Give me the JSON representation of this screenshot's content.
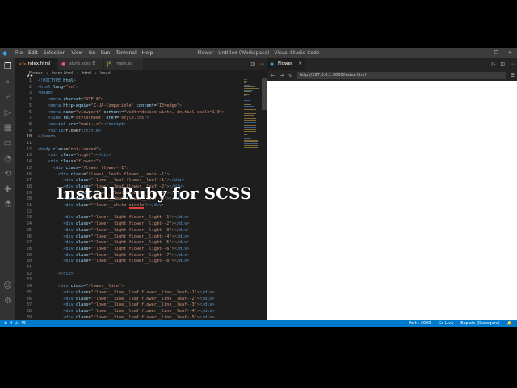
{
  "window": {
    "title": "Flower - Untitled (Workspace) - Visual Studio Code",
    "controls": [
      "–",
      "❐",
      "✕"
    ]
  },
  "menu": [
    "File",
    "Edit",
    "Selection",
    "View",
    "Go",
    "Run",
    "Terminal",
    "Help"
  ],
  "editor_tabs": [
    {
      "label": "index.html 9+",
      "icon": "html-file-icon",
      "active": true
    },
    {
      "label": "style.scss 8",
      "icon": "sass-file-icon",
      "active": false
    },
    {
      "label": "main.js",
      "icon": "js-file-icon",
      "active": false
    }
  ],
  "breadcrumb": [
    "Flower",
    "index.html",
    "html",
    "head"
  ],
  "code_lines": [
    {
      "n": "1",
      "parts": [
        [
          "t",
          "<!"
        ],
        [
          "tg",
          "DOCTYPE"
        ],
        [
          "at",
          " html"
        ],
        [
          "t",
          ">"
        ]
      ]
    },
    {
      "n": "2",
      "parts": [
        [
          "t",
          "<"
        ],
        [
          "tg",
          "html"
        ],
        [
          "at",
          " lang"
        ],
        [
          "tx",
          "="
        ],
        [
          "st",
          "\"en\""
        ],
        [
          "t",
          ">"
        ]
      ]
    },
    {
      "n": "3",
      "parts": [
        [
          "t",
          "<"
        ],
        [
          "tg",
          "head"
        ],
        [
          "t",
          ">"
        ]
      ]
    },
    {
      "n": "4",
      "parts": [
        [
          "tx",
          "    "
        ],
        [
          "t",
          "<"
        ],
        [
          "tg",
          "meta"
        ],
        [
          "at",
          " charset"
        ],
        [
          "tx",
          "="
        ],
        [
          "st",
          "\"UTF-8\""
        ],
        [
          "t",
          ">"
        ]
      ]
    },
    {
      "n": "5",
      "parts": [
        [
          "tx",
          "    "
        ],
        [
          "t",
          "<"
        ],
        [
          "tg",
          "meta"
        ],
        [
          "at",
          " http-equiv"
        ],
        [
          "tx",
          "="
        ],
        [
          "st",
          "\"X-UA-Compatible\""
        ],
        [
          "at",
          " content"
        ],
        [
          "tx",
          "="
        ],
        [
          "st",
          "\"IE=edge\""
        ],
        [
          "t",
          ">"
        ]
      ]
    },
    {
      "n": "6",
      "parts": [
        [
          "tx",
          "    "
        ],
        [
          "t",
          "<"
        ],
        [
          "tg",
          "meta"
        ],
        [
          "at",
          " name"
        ],
        [
          "tx",
          "="
        ],
        [
          "st",
          "\"viewport\""
        ],
        [
          "at",
          " content"
        ],
        [
          "tx",
          "="
        ],
        [
          "st",
          "\"width=device-width, initial-scale=1.0\""
        ],
        [
          "t",
          ">"
        ]
      ]
    },
    {
      "n": "7",
      "parts": [
        [
          "tx",
          "    "
        ],
        [
          "t",
          "<"
        ],
        [
          "tg",
          "link"
        ],
        [
          "at",
          " rel"
        ],
        [
          "tx",
          "="
        ],
        [
          "st",
          "\"stylesheet\""
        ],
        [
          "at",
          " href"
        ],
        [
          "tx",
          "="
        ],
        [
          "st",
          "\"style.css\""
        ],
        [
          "t",
          ">"
        ]
      ]
    },
    {
      "n": "8",
      "parts": [
        [
          "tx",
          "    "
        ],
        [
          "t",
          "<"
        ],
        [
          "tg",
          "script"
        ],
        [
          "at",
          " src"
        ],
        [
          "tx",
          "="
        ],
        [
          "st",
          "\"main.js\""
        ],
        [
          "t",
          "></"
        ],
        [
          "tg",
          "script"
        ],
        [
          "t",
          ">"
        ]
      ]
    },
    {
      "n": "9",
      "parts": [
        [
          "tx",
          "    "
        ],
        [
          "t",
          "<"
        ],
        [
          "tg",
          "title"
        ],
        [
          "t",
          ">"
        ],
        [
          "tx",
          "Flower"
        ],
        [
          "t",
          "</"
        ],
        [
          "tg",
          "title"
        ],
        [
          "t",
          ">"
        ]
      ]
    },
    {
      "n": "10",
      "parts": [
        [
          "t",
          "</"
        ],
        [
          "tg",
          "head"
        ],
        [
          "t",
          ">"
        ]
      ]
    },
    {
      "n": "11",
      "parts": []
    },
    {
      "n": "12",
      "parts": [
        [
          "t",
          "<"
        ],
        [
          "tg",
          "body"
        ],
        [
          "at",
          " class"
        ],
        [
          "tx",
          "="
        ],
        [
          "st",
          "\"not-loaded\""
        ],
        [
          "t",
          ">"
        ]
      ]
    },
    {
      "n": "13",
      "parts": [
        [
          "tx",
          "    "
        ],
        [
          "t",
          "<"
        ],
        [
          "tg",
          "div"
        ],
        [
          "at",
          " class"
        ],
        [
          "tx",
          "="
        ],
        [
          "st",
          "\"night\""
        ],
        [
          "t",
          "></"
        ],
        [
          "tg",
          "div"
        ],
        [
          "t",
          ">"
        ]
      ]
    },
    {
      "n": "14",
      "parts": [
        [
          "tx",
          "    "
        ],
        [
          "t",
          "<"
        ],
        [
          "tg",
          "div"
        ],
        [
          "at",
          " class"
        ],
        [
          "tx",
          "="
        ],
        [
          "st",
          "\"flowers\""
        ],
        [
          "t",
          ">"
        ]
      ]
    },
    {
      "n": "15",
      "parts": [
        [
          "tx",
          "      "
        ],
        [
          "t",
          "<"
        ],
        [
          "tg",
          "div"
        ],
        [
          "at",
          " class"
        ],
        [
          "tx",
          "="
        ],
        [
          "st",
          "\"flower flower--1\""
        ],
        [
          "t",
          ">"
        ]
      ]
    },
    {
      "n": "16",
      "parts": [
        [
          "tx",
          "        "
        ],
        [
          "t",
          "<"
        ],
        [
          "tg",
          "div"
        ],
        [
          "at",
          " class"
        ],
        [
          "tx",
          "="
        ],
        [
          "st",
          "\"flower__leafs flower__leafs--1\""
        ],
        [
          "t",
          ">"
        ]
      ]
    },
    {
      "n": "17",
      "parts": [
        [
          "tx",
          "          "
        ],
        [
          "t",
          "<"
        ],
        [
          "tg",
          "div"
        ],
        [
          "at",
          " class"
        ],
        [
          "tx",
          "="
        ],
        [
          "st",
          "\"flower__leaf flower__leaf--1\""
        ],
        [
          "t",
          "></"
        ],
        [
          "tg",
          "div"
        ],
        [
          "t",
          ">"
        ]
      ]
    },
    {
      "n": "18",
      "parts": [
        [
          "tx",
          "          "
        ],
        [
          "t",
          "<"
        ],
        [
          "tg",
          "div"
        ],
        [
          "at",
          " class"
        ],
        [
          "tx",
          "="
        ],
        [
          "st",
          "\"flower__leaf flower__leaf--2\""
        ],
        [
          "t",
          "></"
        ],
        [
          "tg",
          "div"
        ],
        [
          "t",
          ">"
        ]
      ]
    },
    {
      "n": "19",
      "parts": [
        [
          "tx",
          "          "
        ],
        [
          "t",
          "<"
        ],
        [
          "tg",
          "div"
        ],
        [
          "at",
          " class"
        ],
        [
          "tx",
          "="
        ],
        [
          "st",
          "\"flower__leaf flower__leaf--3\""
        ],
        [
          "t",
          "></"
        ],
        [
          "tg",
          "div"
        ],
        [
          "t",
          ">"
        ]
      ]
    },
    {
      "n": "20",
      "parts": [
        [
          "tx",
          "          "
        ],
        [
          "t",
          "<"
        ],
        [
          "tg",
          "div"
        ],
        [
          "at",
          " class"
        ],
        [
          "tx",
          "="
        ],
        [
          "st",
          "\"flower__leaf flower__leaf--4\""
        ],
        [
          "t",
          "></"
        ],
        [
          "tg",
          "div"
        ],
        [
          "t",
          ">"
        ]
      ]
    },
    {
      "n": "21",
      "parts": [
        [
          "tx",
          "          "
        ],
        [
          "t",
          "<"
        ],
        [
          "tg",
          "div"
        ],
        [
          "at",
          " class"
        ],
        [
          "tx",
          "="
        ],
        [
          "st",
          "\"flower__white-circle\""
        ],
        [
          "t",
          "></"
        ],
        [
          "tg",
          "div"
        ],
        [
          "t",
          ">"
        ]
      ]
    },
    {
      "n": "22",
      "parts": []
    },
    {
      "n": "23",
      "parts": [
        [
          "tx",
          "          "
        ],
        [
          "t",
          "<"
        ],
        [
          "tg",
          "div"
        ],
        [
          "at",
          " class"
        ],
        [
          "tx",
          "="
        ],
        [
          "st",
          "\"flower__light flower__light--1\""
        ],
        [
          "t",
          "></"
        ],
        [
          "tg",
          "div"
        ],
        [
          "t",
          ">"
        ]
      ]
    },
    {
      "n": "24",
      "parts": [
        [
          "tx",
          "          "
        ],
        [
          "t",
          "<"
        ],
        [
          "tg",
          "div"
        ],
        [
          "at",
          " class"
        ],
        [
          "tx",
          "="
        ],
        [
          "st",
          "\"flower__light flower__light--2\""
        ],
        [
          "t",
          "></"
        ],
        [
          "tg",
          "div"
        ],
        [
          "t",
          ">"
        ]
      ]
    },
    {
      "n": "25",
      "parts": [
        [
          "tx",
          "          "
        ],
        [
          "t",
          "<"
        ],
        [
          "tg",
          "div"
        ],
        [
          "at",
          " class"
        ],
        [
          "tx",
          "="
        ],
        [
          "st",
          "\"flower__light flower__light--3\""
        ],
        [
          "t",
          "></"
        ],
        [
          "tg",
          "div"
        ],
        [
          "t",
          ">"
        ]
      ]
    },
    {
      "n": "26",
      "parts": [
        [
          "tx",
          "          "
        ],
        [
          "t",
          "<"
        ],
        [
          "tg",
          "div"
        ],
        [
          "at",
          " class"
        ],
        [
          "tx",
          "="
        ],
        [
          "st",
          "\"flower__light flower__light--4\""
        ],
        [
          "t",
          "></"
        ],
        [
          "tg",
          "div"
        ],
        [
          "t",
          ">"
        ]
      ]
    },
    {
      "n": "27",
      "parts": [
        [
          "tx",
          "          "
        ],
        [
          "t",
          "<"
        ],
        [
          "tg",
          "div"
        ],
        [
          "at",
          " class"
        ],
        [
          "tx",
          "="
        ],
        [
          "st",
          "\"flower__light flower__light--5\""
        ],
        [
          "t",
          "></"
        ],
        [
          "tg",
          "div"
        ],
        [
          "t",
          ">"
        ]
      ]
    },
    {
      "n": "28",
      "parts": [
        [
          "tx",
          "          "
        ],
        [
          "t",
          "<"
        ],
        [
          "tg",
          "div"
        ],
        [
          "at",
          " class"
        ],
        [
          "tx",
          "="
        ],
        [
          "st",
          "\"flower__light flower__light--6\""
        ],
        [
          "t",
          "></"
        ],
        [
          "tg",
          "div"
        ],
        [
          "t",
          ">"
        ]
      ]
    },
    {
      "n": "29",
      "parts": [
        [
          "tx",
          "          "
        ],
        [
          "t",
          "<"
        ],
        [
          "tg",
          "div"
        ],
        [
          "at",
          " class"
        ],
        [
          "tx",
          "="
        ],
        [
          "st",
          "\"flower__light flower__light--7\""
        ],
        [
          "t",
          "></"
        ],
        [
          "tg",
          "div"
        ],
        [
          "t",
          ">"
        ]
      ]
    },
    {
      "n": "30",
      "parts": [
        [
          "tx",
          "          "
        ],
        [
          "t",
          "<"
        ],
        [
          "tg",
          "div"
        ],
        [
          "at",
          " class"
        ],
        [
          "tx",
          "="
        ],
        [
          "st",
          "\"flower__light flower__light--8\""
        ],
        [
          "t",
          "></"
        ],
        [
          "tg",
          "div"
        ],
        [
          "t",
          ">"
        ]
      ]
    },
    {
      "n": "31",
      "parts": []
    },
    {
      "n": "32",
      "parts": [
        [
          "tx",
          "        "
        ],
        [
          "t",
          "</"
        ],
        [
          "tg",
          "div"
        ],
        [
          "t",
          ">"
        ]
      ]
    },
    {
      "n": "33",
      "parts": []
    },
    {
      "n": "34",
      "parts": [
        [
          "tx",
          "        "
        ],
        [
          "t",
          "<"
        ],
        [
          "tg",
          "div"
        ],
        [
          "at",
          " class"
        ],
        [
          "tx",
          "="
        ],
        [
          "st",
          "\"flower__line\""
        ],
        [
          "t",
          ">"
        ]
      ]
    },
    {
      "n": "35",
      "parts": [
        [
          "tx",
          "          "
        ],
        [
          "t",
          "<"
        ],
        [
          "tg",
          "div"
        ],
        [
          "at",
          " class"
        ],
        [
          "tx",
          "="
        ],
        [
          "st",
          "\"flower__line__leaf flower__line__leaf--1\""
        ],
        [
          "t",
          "></"
        ],
        [
          "tg",
          "div"
        ],
        [
          "t",
          ">"
        ]
      ]
    },
    {
      "n": "36",
      "parts": [
        [
          "tx",
          "          "
        ],
        [
          "t",
          "<"
        ],
        [
          "tg",
          "div"
        ],
        [
          "at",
          " class"
        ],
        [
          "tx",
          "="
        ],
        [
          "st",
          "\"flower__line__leaf flower__line__leaf--2\""
        ],
        [
          "t",
          "></"
        ],
        [
          "tg",
          "div"
        ],
        [
          "t",
          ">"
        ]
      ]
    },
    {
      "n": "37",
      "parts": [
        [
          "tx",
          "          "
        ],
        [
          "t",
          "<"
        ],
        [
          "tg",
          "div"
        ],
        [
          "at",
          " class"
        ],
        [
          "tx",
          "="
        ],
        [
          "st",
          "\"flower__line__leaf flower__line__leaf--3\""
        ],
        [
          "t",
          "></"
        ],
        [
          "tg",
          "div"
        ],
        [
          "t",
          ">"
        ]
      ]
    },
    {
      "n": "38",
      "parts": [
        [
          "tx",
          "          "
        ],
        [
          "t",
          "<"
        ],
        [
          "tg",
          "div"
        ],
        [
          "at",
          " class"
        ],
        [
          "tx",
          "="
        ],
        [
          "st",
          "\"flower__line__leaf flower__line__leaf--4\""
        ],
        [
          "t",
          "></"
        ],
        [
          "tg",
          "div"
        ],
        [
          "t",
          ">"
        ]
      ]
    },
    {
      "n": "39",
      "parts": [
        [
          "tx",
          "          "
        ],
        [
          "t",
          "<"
        ],
        [
          "tg",
          "div"
        ],
        [
          "at",
          " class"
        ],
        [
          "tx",
          "="
        ],
        [
          "st",
          "\"flower__line__leaf flower__line__leaf--5\""
        ],
        [
          "t",
          "></"
        ],
        [
          "tg",
          "div"
        ],
        [
          "t",
          ">"
        ]
      ]
    }
  ],
  "overlay_title": "Install Ruby for SCSS",
  "browser": {
    "tab_label": "Flower",
    "url": "http://127.0.0.1:3000/index.html"
  },
  "status_bar": {
    "errors": "0",
    "warnings": "45",
    "port": "Port : 3000",
    "go_live": "Go Live",
    "explain": "Explain (Deneguru)"
  },
  "colors": {
    "status_bar": "#007acc",
    "activity_bar": "#333333",
    "editor_bg": "#1e1e1e",
    "tag": "#569cd6",
    "attribute": "#9cdcfe",
    "string": "#ce9178"
  }
}
